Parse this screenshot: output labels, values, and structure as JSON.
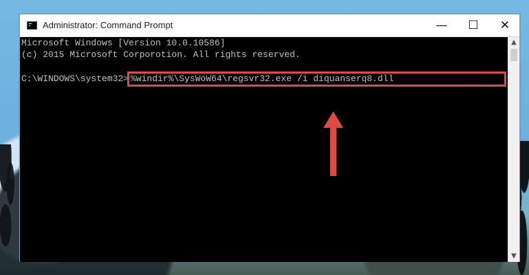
{
  "window": {
    "title": "Administrator: Command Prompt",
    "buttons": {
      "minimize": "—",
      "maximize": "☐",
      "close": "✕"
    }
  },
  "console": {
    "line_1": "Microsoft Windows [Version 10.0.10586]",
    "line_2": "(c) 2015 Microsoft Corporotion. All rights reserved.",
    "prompt": "C:\\WINDOWS\\system32>",
    "command": "%windir%\\SysWoW64\\regsvr32.exe /i diquanserq8.dll"
  },
  "colors": {
    "highlight": "#df4a45",
    "arrow": "#df4a45",
    "console_background": "#000000",
    "console_text": "#c0c0c0"
  },
  "icons": {
    "app": "command-prompt-icon",
    "minimize": "minimize-icon",
    "maximize": "maximize-icon",
    "close": "close-icon",
    "arrow": "up-arrow-icon",
    "scroll_up": "scroll-up-icon",
    "scroll_down": "scroll-down-icon"
  }
}
